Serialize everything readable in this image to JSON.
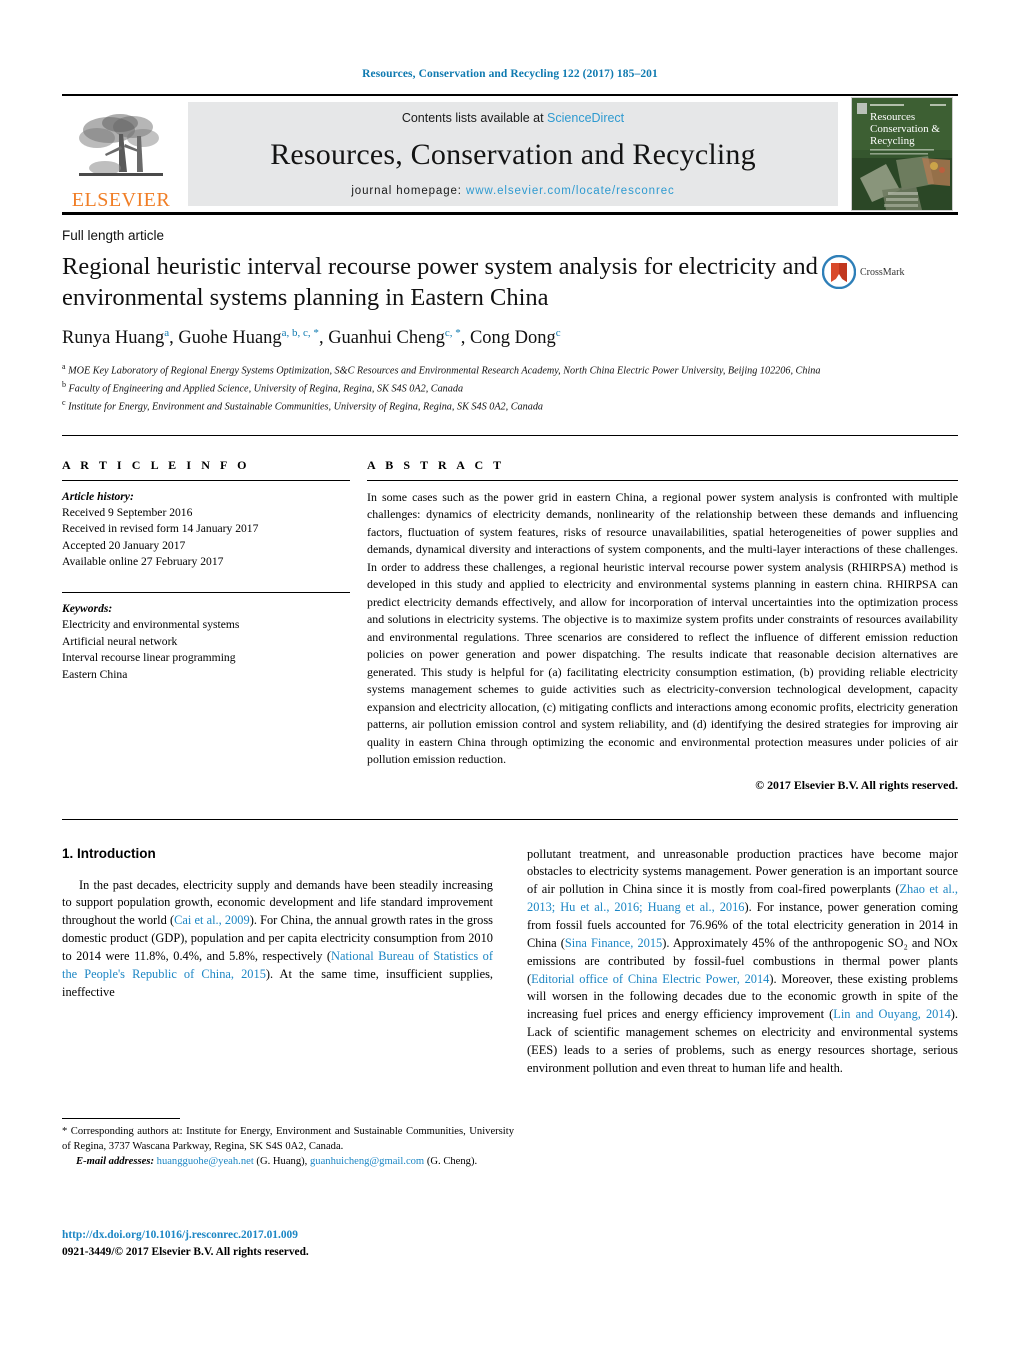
{
  "running_head": "Resources, Conservation and Recycling 122 (2017) 185–201",
  "masthead": {
    "contents_prefix": "Contents lists available at ",
    "sciencedirect": "ScienceDirect",
    "journal_title": "Resources, Conservation and Recycling",
    "homepage_label": "journal homepage:",
    "homepage_url": "www.elsevier.com/locate/resconrec",
    "publisher_logo_text": "ELSEVIER",
    "cover_title_line1": "Resources",
    "cover_title_line2": "Conservation &",
    "cover_title_line3": "Recycling",
    "accent_link_color": "#2e9ad0",
    "elsevier_orange": "#f07e26",
    "masthead_bg": "#e6e7e8"
  },
  "article": {
    "type": "Full length article",
    "title": "Regional heuristic interval recourse power system analysis for electricity and environmental systems planning in Eastern China",
    "crossmark_label": "CrossMark",
    "authors": [
      {
        "name": "Runya Huang",
        "marks": "a"
      },
      {
        "name": "Guohe Huang",
        "marks": "a, b, c, *"
      },
      {
        "name": "Guanhui Cheng",
        "marks": "c, *"
      },
      {
        "name": "Cong Dong",
        "marks": "c"
      }
    ],
    "affiliations": [
      {
        "mark": "a",
        "text": "MOE Key Laboratory of Regional Energy Systems Optimization, S&C Resources and Environmental Research Academy, North China Electric Power University, Beijing 102206, China"
      },
      {
        "mark": "b",
        "text": "Faculty of Engineering and Applied Science, University of Regina, Regina, SK S4S 0A2, Canada"
      },
      {
        "mark": "c",
        "text": "Institute for Energy, Environment and Sustainable Communities, University of Regina, Regina, SK S4S 0A2, Canada"
      }
    ]
  },
  "article_info": {
    "heading": "A R T I C L E  I N F O",
    "history_label": "Article history:",
    "history": [
      "Received 9 September 2016",
      "Received in revised form 14 January 2017",
      "Accepted 20 January 2017",
      "Available online 27 February 2017"
    ],
    "keywords_label": "Keywords:",
    "keywords": [
      "Electricity and environmental systems",
      "Artificial neural network",
      "Interval recourse linear programming",
      "Eastern China"
    ]
  },
  "abstract": {
    "heading": "A B S T R A C T",
    "text": "In some cases such as the power grid in eastern China, a regional power system analysis is confronted with multiple challenges: dynamics of electricity demands, nonlinearity of the relationship between these demands and influencing factors, fluctuation of system features, risks of resource unavailabilities, spatial heterogeneities of power supplies and demands, dynamical diversity and interactions of system components, and the multi-layer interactions of these challenges. In order to address these challenges, a regional heuristic interval recourse power system analysis (RHIRPSA) method is developed in this study and applied to electricity and environmental systems planning in eastern china. RHIRPSA can predict electricity demands effectively, and allow for incorporation of interval uncertainties into the optimization process and solutions in electricity systems. The objective is to maximize system profits under constraints of resources availability and environmental regulations. Three scenarios are considered to reflect the influence of different emission reduction policies on power generation and power dispatching. The results indicate that reasonable decision alternatives are generated. This study is helpful for (a) facilitating electricity consumption estimation, (b) providing reliable electricity systems management schemes to guide activities such as electricity-conversion technological development, capacity expansion and electricity allocation, (c) mitigating conflicts and interactions among economic profits, electricity generation patterns, air pollution emission control and system reliability, and (d) identifying the desired strategies for improving air quality in eastern China through optimizing the economic and environmental protection measures under policies of air pollution emission reduction.",
    "copyright": "© 2017 Elsevier B.V. All rights reserved."
  },
  "introduction": {
    "heading": "1. Introduction",
    "left_paragraph_parts": [
      {
        "t": "In the past decades, electricity supply and demands have been steadily increasing to support population growth, economic development and life standard improvement throughout the world (",
        "link": false
      },
      {
        "t": "Cai et al., 2009",
        "link": true
      },
      {
        "t": "). For China, the annual growth rates in the gross domestic product (GDP), population and per capita electricity consumption from 2010 to 2014 were 11.8%, 0.4%, and 5.8%, respectively (",
        "link": false
      },
      {
        "t": "National Bureau of Statistics of the People's Republic of China, 2015",
        "link": true
      },
      {
        "t": "). At the same time, insufficient supplies, ineffective",
        "link": false
      }
    ],
    "right_paragraph_parts": [
      {
        "t": "pollutant treatment, and unreasonable production practices have become major obstacles to electricity systems management. Power generation is an important source of air pollution in China since it is mostly from coal-fired powerplants (",
        "link": false
      },
      {
        "t": "Zhao et al., 2013; Hu et al., 2016; Huang et al., 2016",
        "link": true
      },
      {
        "t": "). For instance, power generation coming from fossil fuels accounted for 76.96% of the total electricity generation in 2014 in China (",
        "link": false
      },
      {
        "t": "Sina Finance, 2015",
        "link": true
      },
      {
        "t": "). Approximately 45% of the anthropogenic SO₂ and NOx emissions are contributed by fossil-fuel combustions in thermal power plants (",
        "link": false
      },
      {
        "t": "Editorial office of China Electric Power, 2014",
        "link": true
      },
      {
        "t": "). Moreover, these existing problems will worsen in the following decades due to the economic growth in spite of the increasing fuel prices and energy efficiency improvement (",
        "link": false
      },
      {
        "t": "Lin and Ouyang, 2014",
        "link": true
      },
      {
        "t": "). Lack of scientific management schemes on electricity and environmental systems (EES) leads to a series of problems, such as energy resources shortage, serious environment pollution and even threat to human life and health.",
        "link": false
      }
    ]
  },
  "footnote": {
    "corresponding": "* Corresponding authors at: Institute for Energy, Environment and Sustainable Communities, University of Regina, 3737 Wascana Parkway, Regina, SK S4S 0A2, Canada.",
    "email_label": "E-mail addresses:",
    "email_1": "huangguohe@yeah.net",
    "email_1_owner": "(G. Huang),",
    "email_2": "guanhuicheng@gmail.com",
    "email_2_owner": "(G. Cheng)."
  },
  "doi": {
    "url": "http://dx.doi.org/10.1016/j.resconrec.2017.01.009",
    "issn_line": "0921-3449/© 2017 Elsevier B.V. All rights reserved."
  }
}
